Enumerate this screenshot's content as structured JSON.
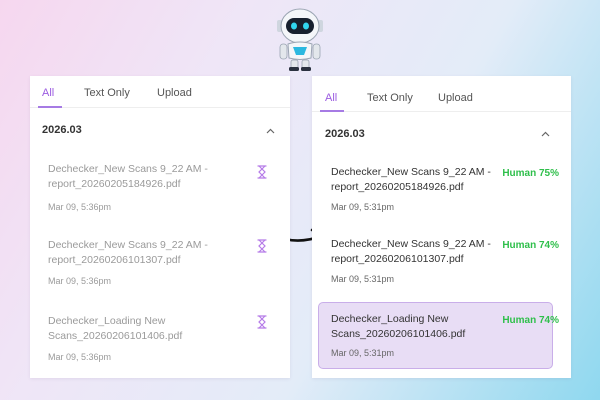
{
  "colors": {
    "accent": "#9b5be0",
    "human": "#2fbf4b",
    "selected": "#e8ddf5"
  },
  "tabs": [
    "All",
    "Text Only",
    "Upload"
  ],
  "group_label": "2026.03",
  "left_items": [
    {
      "title": "Dechecker_New Scans 9_22 AM - report_20260205184926.pdf",
      "date": "Mar 09, 5:36pm",
      "status": "processing"
    },
    {
      "title": "Dechecker_New Scans 9_22 AM - report_20260206101307.pdf",
      "date": "Mar 09, 5:36pm",
      "status": "processing"
    },
    {
      "title": "Dechecker_Loading New Scans_20260206101406.pdf",
      "date": "Mar 09, 5:36pm",
      "status": "processing"
    }
  ],
  "right_items": [
    {
      "title": "Dechecker_New Scans 9_22 AM - report_20260205184926.pdf",
      "date": "Mar 09, 5:31pm",
      "score": "Human 75%"
    },
    {
      "title": "Dechecker_New Scans 9_22 AM - report_20260206101307.pdf",
      "date": "Mar 09, 5:31pm",
      "score": "Human 74%"
    },
    {
      "title": "Dechecker_Loading New Scans_20260206101406.pdf",
      "date": "Mar 09, 5:31pm",
      "score": "Human 74%",
      "selected": true
    }
  ]
}
